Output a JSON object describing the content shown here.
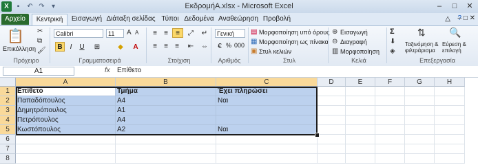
{
  "window": {
    "title": "ΕκδρομήΑ.xlsx  -  Microsoft Excel",
    "qat_icons": [
      "excel-logo-icon",
      "save-icon",
      "undo-icon",
      "redo-icon",
      "customize-icon"
    ],
    "controls": [
      "minimize-icon",
      "restore-icon",
      "close-icon"
    ]
  },
  "tabs": [
    "Αρχείο",
    "Κεντρική",
    "Εισαγωγή",
    "Διάταξη σελίδας",
    "Τύποι",
    "Δεδομένα",
    "Αναθεώρηση",
    "Προβολή"
  ],
  "active_tab": "Κεντρική",
  "ribbon": {
    "clipboard": {
      "label": "Πρόχειρο",
      "paste": "Επικόλληση"
    },
    "font": {
      "label": "Γραμματοσειρά",
      "name": "Calibri",
      "size": "11"
    },
    "alignment": {
      "label": "Στοίχιση"
    },
    "number": {
      "label": "Αριθμός",
      "format": "Γενική",
      "percent": "%",
      "comma": "000"
    },
    "styles": {
      "label": "Στυλ",
      "conditional": "Μορφοποίηση υπό όρους",
      "as_table": "Μορφοποίηση ως πίνακα",
      "cell_styles": "Στυλ κελιών"
    },
    "cells": {
      "label": "Κελιά",
      "insert": "Εισαγωγή",
      "delete": "Διαγραφή",
      "format": "Μορφοποίηση"
    },
    "editing": {
      "label": "Επεξεργασία",
      "sigma": "Σ",
      "sort_1": "Ταξινόμηση &",
      "sort_2": "φιλτράρισμα",
      "find_1": "Εύρεση &",
      "find_2": "επιλογή"
    }
  },
  "formula_bar": {
    "name_box": "A1",
    "fx": "fx",
    "value": "Επίθετο"
  },
  "grid": {
    "columns": [
      "A",
      "B",
      "C",
      "D",
      "E",
      "F",
      "G",
      "H"
    ],
    "rows": [
      "1",
      "2",
      "3",
      "4",
      "5",
      "6",
      "7",
      "8"
    ],
    "cells": [
      [
        "Επίθετο",
        "Τμήμα",
        "Έχει πληρώσει"
      ],
      [
        "Παπαδόπουλος",
        "Α4",
        "Ναι"
      ],
      [
        "Δημητρόπουλος",
        "Α1",
        ""
      ],
      [
        "Πετρόπουλος",
        "Α4",
        ""
      ],
      [
        "Κωστόπουλος",
        "Α2",
        "Ναι"
      ]
    ],
    "selection": "A1:C5",
    "colors": {
      "selection_fill": "#bcd1ee",
      "header_selected": "#f9d99a",
      "file_tab": "#2a6b2e"
    }
  }
}
